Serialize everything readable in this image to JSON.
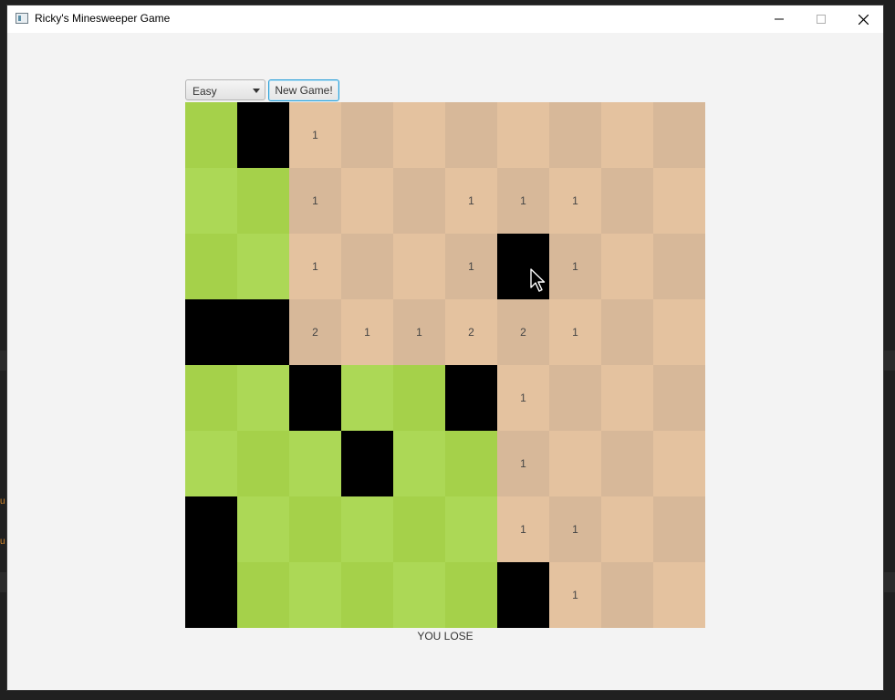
{
  "window": {
    "title": "Ricky's Minesweeper Game"
  },
  "icons": {
    "app": "app-icon",
    "minimize": "minimize-icon",
    "maximize": "maximize-icon",
    "close": "close-icon",
    "dropdown": "chevron-down-icon",
    "cursor": "mouse-pointer-icon"
  },
  "toolbar": {
    "difficulty_selected": "Easy",
    "new_game_label": "New Game!"
  },
  "board": {
    "rows": 8,
    "cols": 10,
    "cells": [
      [
        "G",
        "M",
        "1",
        "",
        "",
        "",
        "",
        "",
        "",
        ""
      ],
      [
        "G",
        "G",
        "1",
        "",
        "",
        "1",
        "1",
        "1",
        "",
        ""
      ],
      [
        "G",
        "G",
        "1",
        "",
        "",
        "1",
        "M",
        "1",
        "",
        ""
      ],
      [
        "M",
        "M",
        "2",
        "1",
        "1",
        "2",
        "2",
        "1",
        "",
        ""
      ],
      [
        "G",
        "G",
        "M",
        "G",
        "G",
        "M",
        "1",
        "",
        "",
        ""
      ],
      [
        "G",
        "G",
        "G",
        "M",
        "G",
        "G",
        "1",
        "",
        "",
        ""
      ],
      [
        "M",
        "G",
        "G",
        "G",
        "G",
        "G",
        "1",
        "1",
        "",
        ""
      ],
      [
        "M",
        "G",
        "G",
        "G",
        "G",
        "G",
        "M",
        "1",
        "",
        ""
      ]
    ]
  },
  "colors": {
    "grass_dark": "#a5d14a",
    "grass_light": "#acd856",
    "sand_dark": "#d7b899",
    "sand_light": "#e4c29f",
    "mine": "#000000"
  },
  "status": {
    "message": "YOU LOSE"
  },
  "background_marks": [
    "u",
    "u"
  ]
}
